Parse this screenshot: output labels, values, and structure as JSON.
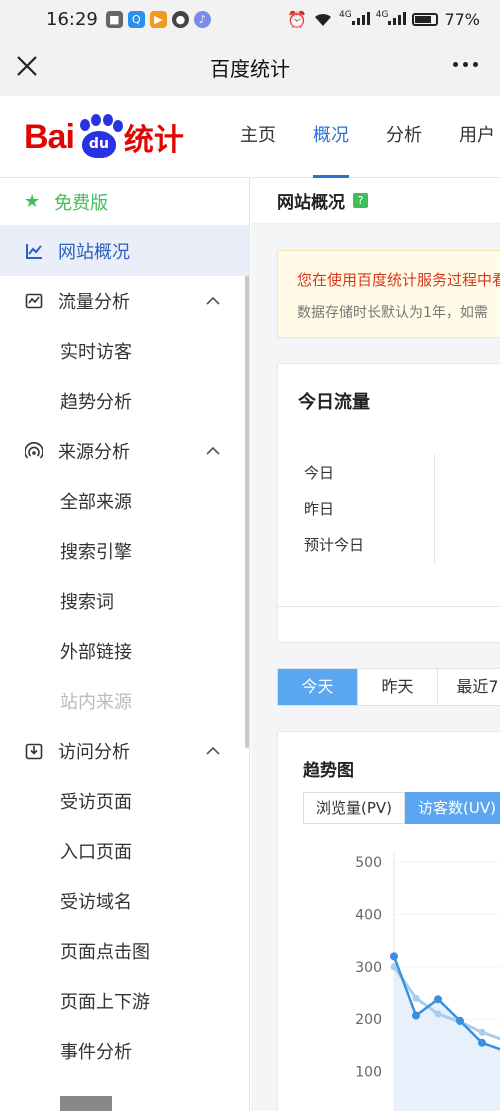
{
  "status_bar": {
    "time": "16:29",
    "battery": "77%",
    "signal_labels": [
      "4G",
      "4G"
    ]
  },
  "titlebar": {
    "title": "百度统计"
  },
  "logo": {
    "bai": "Bai",
    "du": "du",
    "tongji": "统计"
  },
  "topnav": {
    "items": [
      "主页",
      "概况",
      "分析",
      "用户"
    ],
    "active_index": 1
  },
  "sidebar": {
    "free_label": "免费版",
    "items": [
      {
        "label": "网站概况",
        "icon": "line-chart-icon",
        "active": true
      },
      {
        "label": "流量分析",
        "icon": "traffic-chart-icon",
        "expanded": true,
        "children": [
          "实时访客",
          "趋势分析"
        ]
      },
      {
        "label": "来源分析",
        "icon": "broadcast-icon",
        "expanded": true,
        "children": [
          "全部来源",
          "搜索引擎",
          "搜索词",
          "外部链接",
          "站内来源"
        ]
      },
      {
        "label": "访问分析",
        "icon": "download-box-icon",
        "expanded": true,
        "children": [
          "受访页面",
          "入口页面",
          "受访域名",
          "页面点击图",
          "页面上下游",
          "事件分析"
        ]
      }
    ]
  },
  "main": {
    "page_title": "网站概况",
    "help_label": "?",
    "notice": {
      "line1": "您在使用百度统计服务过程中看",
      "line2": "数据存储时长默认为1年，如需"
    },
    "today_card": {
      "title": "今日流量",
      "rows": [
        "今日",
        "昨日",
        "预计今日"
      ]
    },
    "range_tabs": [
      "今天",
      "昨天",
      "最近7"
    ],
    "range_active": 0,
    "trend": {
      "title": "趋势图",
      "metrics": [
        "浏览量(PV)",
        "访客数(UV)"
      ],
      "metric_active": 1
    }
  },
  "colors": {
    "accent": "#2d6fd6",
    "brand_red": "#e10602",
    "brand_blue": "#2932e1",
    "free_green": "#3fbf5a",
    "tab_active": "#5aa6f0"
  },
  "chart_data": {
    "type": "line",
    "title": "趋势图",
    "ylim": [
      0,
      500
    ],
    "y_ticks": [
      500,
      400,
      300,
      200,
      100
    ],
    "x": [
      0,
      1,
      2,
      3,
      4,
      5
    ],
    "series": [
      {
        "name": "访客数(UV)",
        "values": [
          320,
          207,
          238,
          197,
          155,
          140
        ],
        "color": "#3d8fdc"
      },
      {
        "values": [
          300,
          240,
          210,
          195,
          175,
          160
        ],
        "color": "#a8cdee"
      }
    ]
  }
}
